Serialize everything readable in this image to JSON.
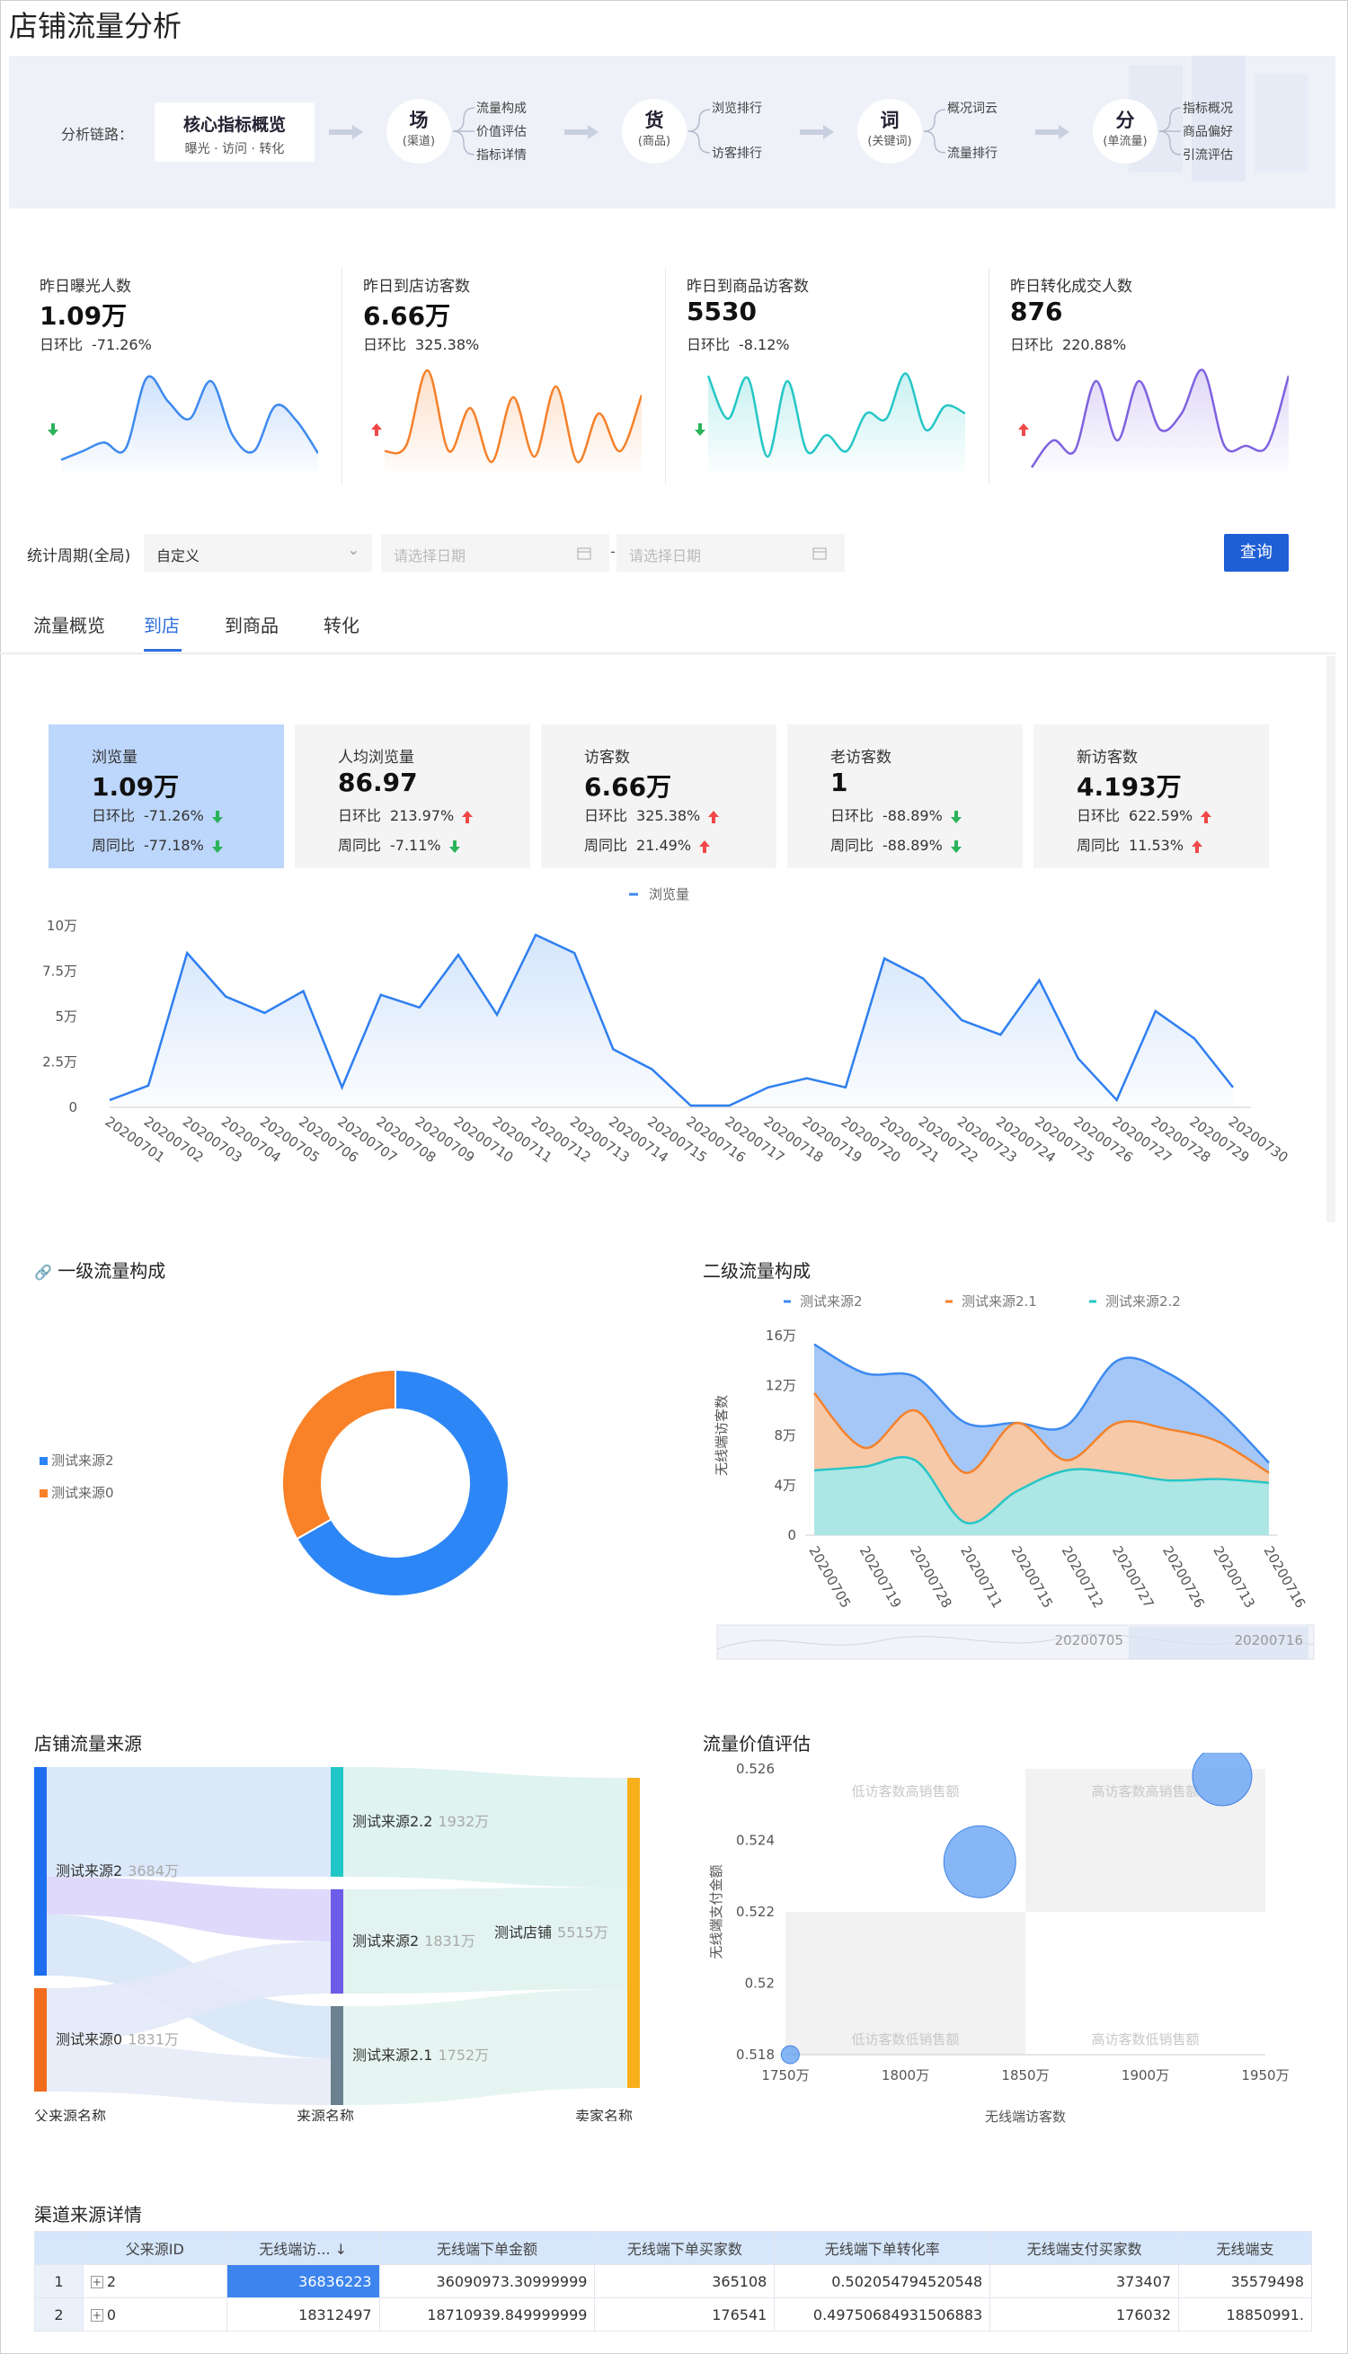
{
  "page_title": "店铺流量分析",
  "chain": {
    "label": "分析链路：",
    "core_title": "核心指标概览",
    "core_sub": "曝光 · 访问 · 转化",
    "nodes": [
      {
        "big": "场",
        "sub": "(渠道)",
        "items": [
          "流量构成",
          "价值评估",
          "指标详情"
        ]
      },
      {
        "big": "货",
        "sub": "(商品)",
        "items": [
          "浏览排行",
          "访客排行"
        ]
      },
      {
        "big": "词",
        "sub": "(关键词)",
        "items": [
          "概况词云",
          "流量排行"
        ]
      },
      {
        "big": "分",
        "sub": "(单流量)",
        "items": [
          "指标概况",
          "商品偏好",
          "引流评估"
        ]
      }
    ]
  },
  "kpis": [
    {
      "label": "昨日曝光人数",
      "value": "1.09万",
      "ratio_label": "日环比",
      "ratio": "-71.26%",
      "dir": "down",
      "color": "#3d8af0",
      "spark": [
        0.12,
        0.2,
        0.28,
        0.22,
        0.88,
        0.66,
        0.5,
        0.85,
        0.35,
        0.2,
        0.62,
        0.48,
        0.18
      ]
    },
    {
      "label": "昨日到店访客数",
      "value": "6.66万",
      "ratio_label": "日环比",
      "ratio": "325.38%",
      "dir": "up",
      "color": "#f5812a",
      "spark": [
        0.2,
        0.25,
        0.95,
        0.2,
        0.6,
        0.1,
        0.7,
        0.15,
        0.8,
        0.1,
        0.55,
        0.2,
        0.72
      ]
    },
    {
      "label": "昨日到商品访客数",
      "value": "5530",
      "ratio_label": "日环比",
      "ratio": "-8.12%",
      "dir": "down",
      "color": "#26c6c6",
      "spark": [
        0.9,
        0.5,
        0.88,
        0.15,
        0.85,
        0.2,
        0.35,
        0.2,
        0.55,
        0.5,
        0.92,
        0.4,
        0.62,
        0.55
      ]
    },
    {
      "label": "昨日转化成交人数",
      "value": "876",
      "ratio_label": "日环比",
      "ratio": "220.88%",
      "dir": "up",
      "color": "#7e62e0",
      "spark": [
        0.05,
        0.3,
        0.2,
        0.85,
        0.3,
        0.85,
        0.4,
        0.55,
        0.95,
        0.25,
        0.25,
        0.25,
        0.9
      ]
    }
  ],
  "filter": {
    "label": "统计周期(全局)",
    "select": "自定义",
    "start_ph": "请选择日期",
    "end_ph": "请选择日期",
    "sep": "-",
    "query": "查询"
  },
  "tabs": [
    "流量概览",
    "到店",
    "到商品",
    "转化"
  ],
  "cards": [
    {
      "label": "浏览量",
      "value": "1.09万",
      "r1_label": "日环比",
      "r1": "-71.26%",
      "r1_dir": "down",
      "r2_label": "周同比",
      "r2": "-77.18%",
      "r2_dir": "down"
    },
    {
      "label": "人均浏览量",
      "value": "86.97",
      "r1_label": "日环比",
      "r1": "213.97%",
      "r1_dir": "up",
      "r2_label": "周同比",
      "r2": "-7.11%",
      "r2_dir": "down"
    },
    {
      "label": "访客数",
      "value": "6.66万",
      "r1_label": "日环比",
      "r1": "325.38%",
      "r1_dir": "up",
      "r2_label": "周同比",
      "r2": "21.49%",
      "r2_dir": "up"
    },
    {
      "label": "老访客数",
      "value": "1",
      "r1_label": "日环比",
      "r1": "-88.89%",
      "r1_dir": "down",
      "r2_label": "周同比",
      "r2": "-88.89%",
      "r2_dir": "down"
    },
    {
      "label": "新访客数",
      "value": "4.193万",
      "r1_label": "日环比",
      "r1": "622.59%",
      "r1_dir": "up",
      "r2_label": "周同比",
      "r2": "11.53%",
      "r2_dir": "up"
    }
  ],
  "chart_data": [
    {
      "type": "area",
      "legend": "浏览量",
      "ylim": [
        0,
        100000
      ],
      "yticks": [
        "0",
        "2.5万",
        "5万",
        "7.5万",
        "10万"
      ],
      "x": [
        "20200701",
        "20200702",
        "20200703",
        "20200704",
        "20200705",
        "20200706",
        "20200707",
        "20200708",
        "20200709",
        "20200710",
        "20200711",
        "20200712",
        "20200713",
        "20200714",
        "20200715",
        "20200716",
        "20200717",
        "20200718",
        "20200719",
        "20200720",
        "20200721",
        "20200722",
        "20200723",
        "20200724",
        "20200725",
        "20200726",
        "20200727",
        "20200728",
        "20200729",
        "20200730"
      ],
      "values": [
        4000,
        12000,
        85000,
        61000,
        52000,
        64000,
        11000,
        62000,
        55000,
        84000,
        51000,
        95000,
        85000,
        32000,
        21000,
        1000,
        1000,
        11000,
        16000,
        11000,
        82000,
        71000,
        48000,
        40000,
        70000,
        27000,
        4000,
        53000,
        38000,
        11000
      ]
    },
    {
      "type": "pie",
      "title": "一级流量构成",
      "labels": [
        "测试来源2",
        "测试来源0"
      ],
      "values": [
        3684,
        1831
      ],
      "colors": [
        "#2d86f6",
        "#f98127"
      ]
    },
    {
      "type": "area",
      "title": "二级流量构成",
      "ylabel": "无线端访客数",
      "yticks": [
        "0",
        "4万",
        "8万",
        "12万",
        "16万"
      ],
      "ylim": [
        0,
        160000
      ],
      "x": [
        "20200705",
        "20200719",
        "20200728",
        "20200711",
        "20200715",
        "20200712",
        "20200727",
        "20200726",
        "20200713",
        "20200716"
      ],
      "series": [
        {
          "name": "测试来源2",
          "color": "#3d8af0",
          "values": [
            153000,
            130000,
            127000,
            90000,
            90000,
            88000,
            140000,
            130000,
            100000,
            58000
          ]
        },
        {
          "name": "测试来源2.1",
          "color": "#f5812a",
          "values": [
            114000,
            70000,
            100000,
            50000,
            90000,
            60000,
            90000,
            85000,
            75000,
            50000
          ]
        },
        {
          "name": "测试来源2.2",
          "color": "#26c6c6",
          "values": [
            52000,
            55000,
            60000,
            10000,
            35000,
            52000,
            50000,
            44000,
            45000,
            42000
          ]
        }
      ],
      "slider_start": "20200705",
      "slider_end": "20200716"
    },
    {
      "type": "sankey",
      "title": "店铺流量来源",
      "columns": [
        "父来源名称",
        "来源名称",
        "卖家名称"
      ],
      "nodes": [
        {
          "name": "测试来源2",
          "value": "3684万",
          "color": "#1e6ff0"
        },
        {
          "name": "测试来源0",
          "value": "1831万",
          "color": "#f36b1c"
        },
        {
          "name": "测试来源2.2",
          "value": "1932万",
          "color": "#1fc6c6"
        },
        {
          "name": "测试来源2",
          "value": "1831万",
          "color": "#6c5ce7"
        },
        {
          "name": "测试来源2.1",
          "value": "1752万",
          "color": "#6b8190"
        },
        {
          "name": "测试店铺",
          "value": "5515万",
          "color": "#f7b01b"
        }
      ]
    },
    {
      "type": "scatter",
      "title": "流量价值评估",
      "xlabel": "无线端访客数",
      "ylabel": "无线端支付金额",
      "xticks": [
        "1750万",
        "1800万",
        "1850万",
        "1900万",
        "1950万"
      ],
      "yticks": [
        "0.518",
        "0.52",
        "0.522",
        "0.524",
        "0.526"
      ],
      "xlim": [
        1750,
        1950
      ],
      "ylim": [
        0.518,
        0.526
      ],
      "quadrants": [
        "低访客数高销售额",
        "高访客数高销售额",
        "低访客数低销售额",
        "高访客数低销售额"
      ],
      "points": [
        {
          "x": 1831,
          "y": 0.5234,
          "size": 40
        },
        {
          "x": 1932,
          "y": 0.5258,
          "size": 33
        },
        {
          "x": 1752,
          "y": 0.518,
          "size": 10
        }
      ]
    }
  ],
  "table": {
    "title": "渠道来源详情",
    "headers": [
      "",
      "父来源ID",
      "无线端访... ↓",
      "无线端下单金额",
      "无线端下单买家数",
      "无线端下单转化率",
      "无线端支付买家数",
      "无线端支"
    ],
    "rows": [
      [
        "1",
        "2",
        "36836223",
        "36090973.30999999",
        "365108",
        "0.502054794520548",
        "373407",
        "35579498"
      ],
      [
        "2",
        "0",
        "18312497",
        "18710939.849999999",
        "176541",
        "0.49750684931506883",
        "176032",
        "18850991."
      ]
    ]
  }
}
